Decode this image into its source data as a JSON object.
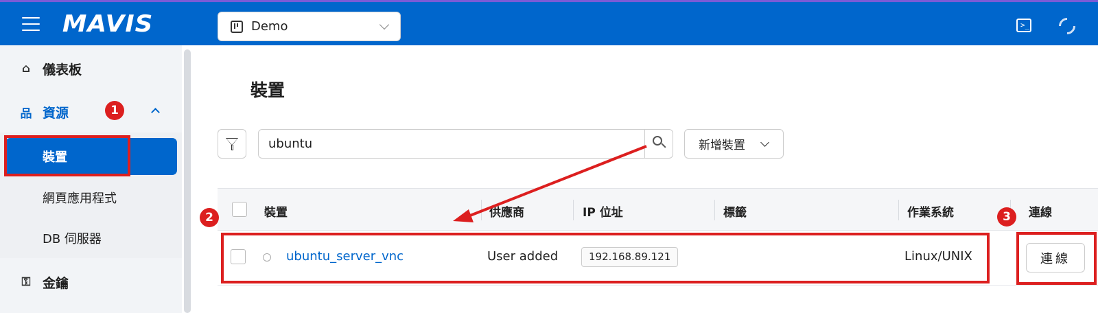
{
  "app": {
    "logo": "MAVIS"
  },
  "project": {
    "name": "Demo"
  },
  "sidebar": {
    "dashboard": "儀表板",
    "resources": "資源",
    "devices": "裝置",
    "web_apps": "網頁應用程式",
    "db_servers": "DB 伺服器",
    "keys": "金鑰"
  },
  "page": {
    "title": "裝置"
  },
  "search": {
    "value": "ubuntu"
  },
  "toolbar": {
    "add_device": "新增裝置"
  },
  "table": {
    "headers": {
      "device": "裝置",
      "vendor": "供應商",
      "ip": "IP 位址",
      "tags": "標籤",
      "os": "作業系統",
      "connect": "連線"
    },
    "rows": [
      {
        "device": "ubuntu_server_vnc",
        "vendor": "User added",
        "ip": "192.168.89.121",
        "tags": "",
        "os": "Linux/UNIX",
        "connect": "連線"
      }
    ]
  },
  "annotations": {
    "badge1": "1",
    "badge2": "2",
    "badge3": "3",
    "color": "#dc1f1f"
  },
  "colors": {
    "brand": "#0066cc",
    "sidebar_bg": "#f2f4f7"
  },
  "icons": [
    "menu-icon",
    "project-icon",
    "terminal-icon",
    "refresh-icon",
    "home-icon",
    "sitemap-icon",
    "key-icon",
    "filter-icon",
    "search-icon",
    "chevron-down-icon",
    "chevron-up-icon"
  ]
}
